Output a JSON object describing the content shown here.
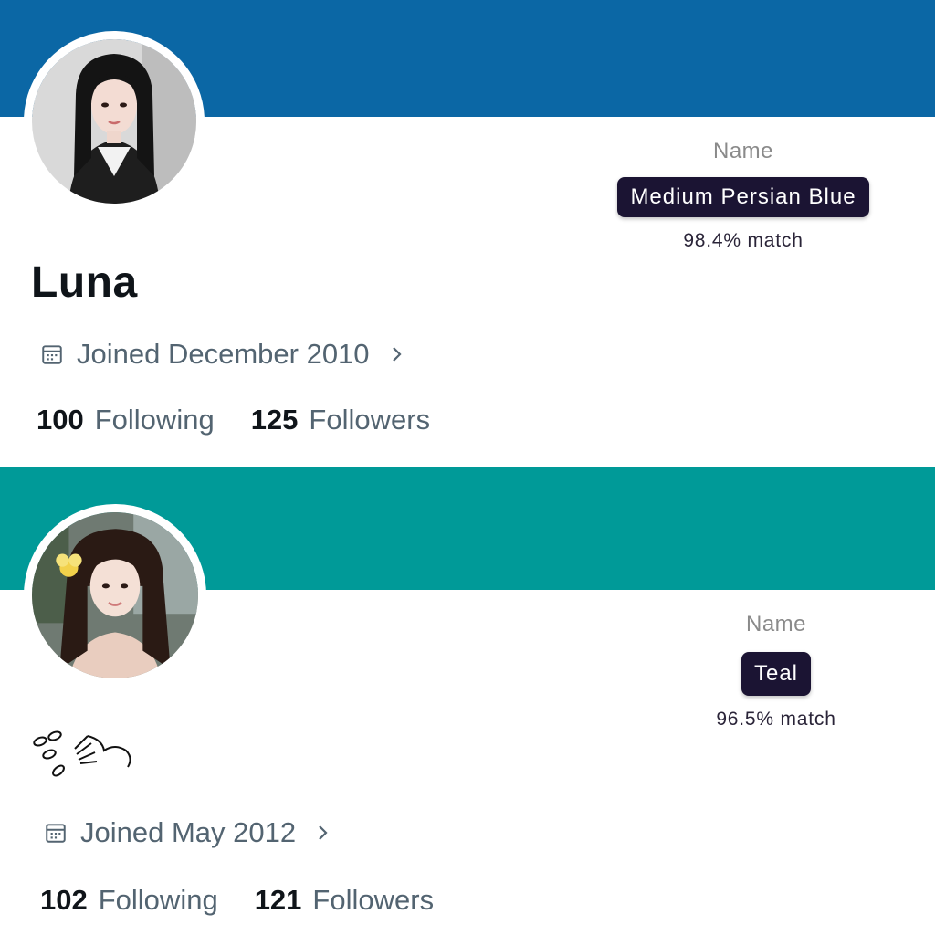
{
  "profiles": [
    {
      "banner_color": "#0b67a5",
      "display_name": "Luna",
      "joined": "Joined December 2010",
      "following_count": "100",
      "following_label": "Following",
      "followers_count": "125",
      "followers_label": "Followers",
      "color_match": {
        "label": "Name",
        "color_name": "Medium Persian Blue",
        "match": "98.4% match"
      }
    },
    {
      "banner_color": "#009a98",
      "display_name_icon": "flower-petals-icon",
      "joined": "Joined May 2012",
      "following_count": "102",
      "following_label": "Following",
      "followers_count": "121",
      "followers_label": "Followers",
      "color_match": {
        "label": "Name",
        "color_name": "Teal",
        "match": "96.5% match"
      }
    }
  ],
  "icons": {
    "calendar": "calendar-icon",
    "chevron": "chevron-right-icon"
  }
}
